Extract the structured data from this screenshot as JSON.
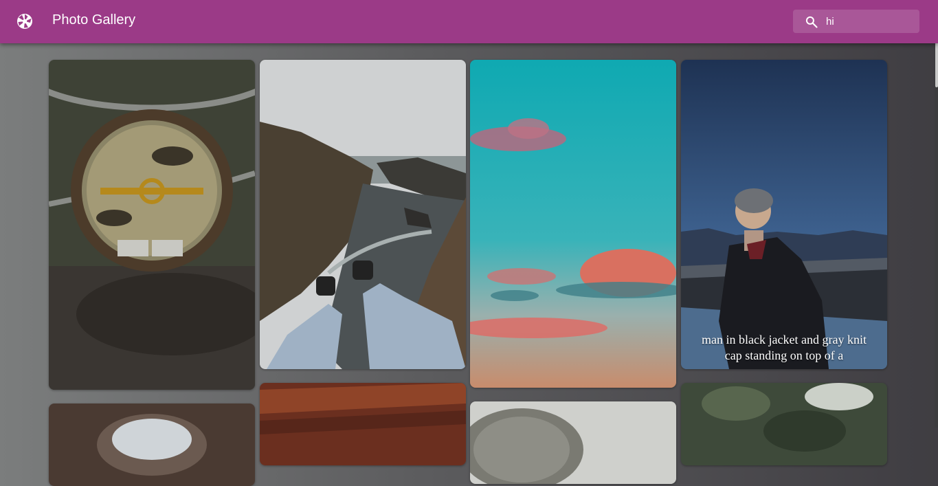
{
  "app": {
    "title": "Photo Gallery",
    "logo_icon": "camera-aperture-icon"
  },
  "search": {
    "value": "hi",
    "icon": "search-icon"
  },
  "colors": {
    "appbar": "#9b3a87",
    "background": "#5c5c5e"
  },
  "photos": [
    {
      "subject": "aerial-helipad",
      "caption": ""
    },
    {
      "subject": "cliff-feet-ocean",
      "caption": ""
    },
    {
      "subject": "pastel-sky-clouds",
      "caption": ""
    },
    {
      "subject": "man-mountain",
      "caption": "man in black jacket and gray knit cap standing on top of a"
    },
    {
      "subject": "brown-cup",
      "caption": ""
    },
    {
      "subject": "red-wood",
      "caption": ""
    },
    {
      "subject": "gray-object",
      "caption": ""
    },
    {
      "subject": "green-foliage",
      "caption": ""
    }
  ]
}
